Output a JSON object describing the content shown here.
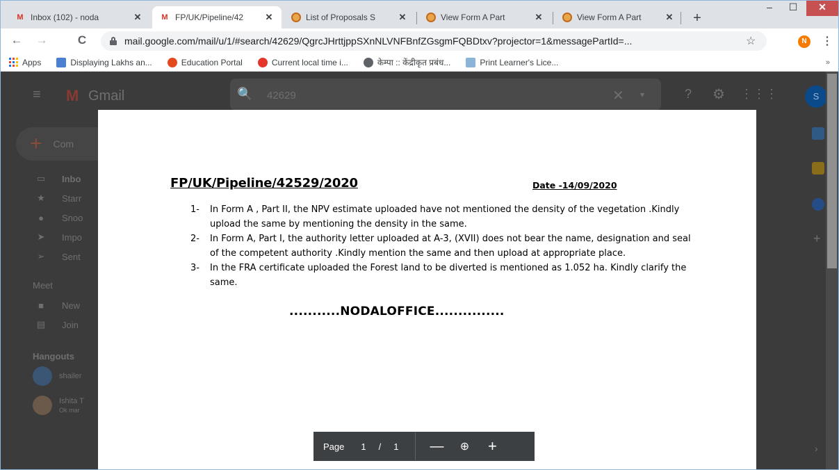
{
  "browser": {
    "tabs": [
      {
        "title": "Inbox (102) - noda",
        "icon": "gmail-icon"
      },
      {
        "title": "FP/UK/Pipeline/42",
        "icon": "gmail-icon"
      },
      {
        "title": "List of Proposals S",
        "icon": "portal-icon"
      },
      {
        "title": "View Form A Part",
        "icon": "portal-icon"
      },
      {
        "title": "View Form A Part",
        "icon": "portal-icon"
      }
    ],
    "tab_close": "✕",
    "new_tab": "+",
    "window": {
      "minimize": "–",
      "maximize": "☐",
      "close": "✕"
    },
    "url": "mail.google.com/mail/u/1/#search/42629/QgrcJHrttjppSXnNLVNFBnfZGsgmFQBDtxv?projector=1&messagePartId=...",
    "star": "☆",
    "profile_initial": "N",
    "menu": "⋮",
    "nav": {
      "back": "←",
      "forward": "→",
      "reload": "C"
    },
    "bookmarks": [
      {
        "label": "Apps"
      },
      {
        "label": "Displaying Lakhs an..."
      },
      {
        "label": "Education Portal"
      },
      {
        "label": "Current local time i..."
      },
      {
        "label": "केम्पा :: केंद्रीकृत प्रबंध..."
      },
      {
        "label": "Print Learner's Lice..."
      }
    ],
    "bookmarks_more": "»"
  },
  "gmail": {
    "menu": "≡",
    "logo": "M",
    "title": "Gmail",
    "search_icon": "🔍",
    "search_query": "42629",
    "clear": "✕",
    "filter": "▾",
    "help": "?",
    "settings": "⚙",
    "apps": "⋮⋮⋮",
    "account_initial": "S",
    "compose_label": "Com",
    "nav": [
      {
        "label": "Inbo",
        "icon": "inbox-icon"
      },
      {
        "label": "Starr",
        "icon": "star-icon"
      },
      {
        "label": "Snoo",
        "icon": "clock-icon"
      },
      {
        "label": "Impo",
        "icon": "important-icon"
      },
      {
        "label": "Sent",
        "icon": "send-icon"
      }
    ],
    "meet_label": "Meet",
    "meet": [
      {
        "label": "New",
        "icon": "video-icon"
      },
      {
        "label": "Join",
        "icon": "keyboard-icon"
      }
    ],
    "hangouts_label": "Hangouts",
    "hangouts": [
      {
        "name": "shailer",
        "sub": ""
      },
      {
        "name": "Ishita T",
        "sub": "Ok mar"
      }
    ],
    "rail_add": "+",
    "rail_collapse": "›"
  },
  "document": {
    "reference": "FP/UK/Pipeline/42529/2020",
    "date": "Date -14/09/2020",
    "items": [
      {
        "num": "1-",
        "text": "In Form A , Part II, the NPV estimate uploaded have not mentioned the density of the vegetation .Kindly upload the same by mentioning the density in the same."
      },
      {
        "num": "2-",
        "text": "In Form A, Part I, the authority letter uploaded at A-3, (XVII) does not bear the name, designation and seal of the competent authority .Kindly mention the same and then upload at appropriate place."
      },
      {
        "num": "3-",
        "text": "In the FRA certificate uploaded the Forest land to be diverted is mentioned as 1.052 ha. Kindly clarify the same."
      }
    ],
    "signature": "...........NODALOFFICE..............."
  },
  "pdf_controls": {
    "page_label": "Page",
    "page_current": "1",
    "page_sep": "/",
    "page_total": "1",
    "zoom_out": "—",
    "zoom_fit": "⊕",
    "zoom_in": "+"
  }
}
